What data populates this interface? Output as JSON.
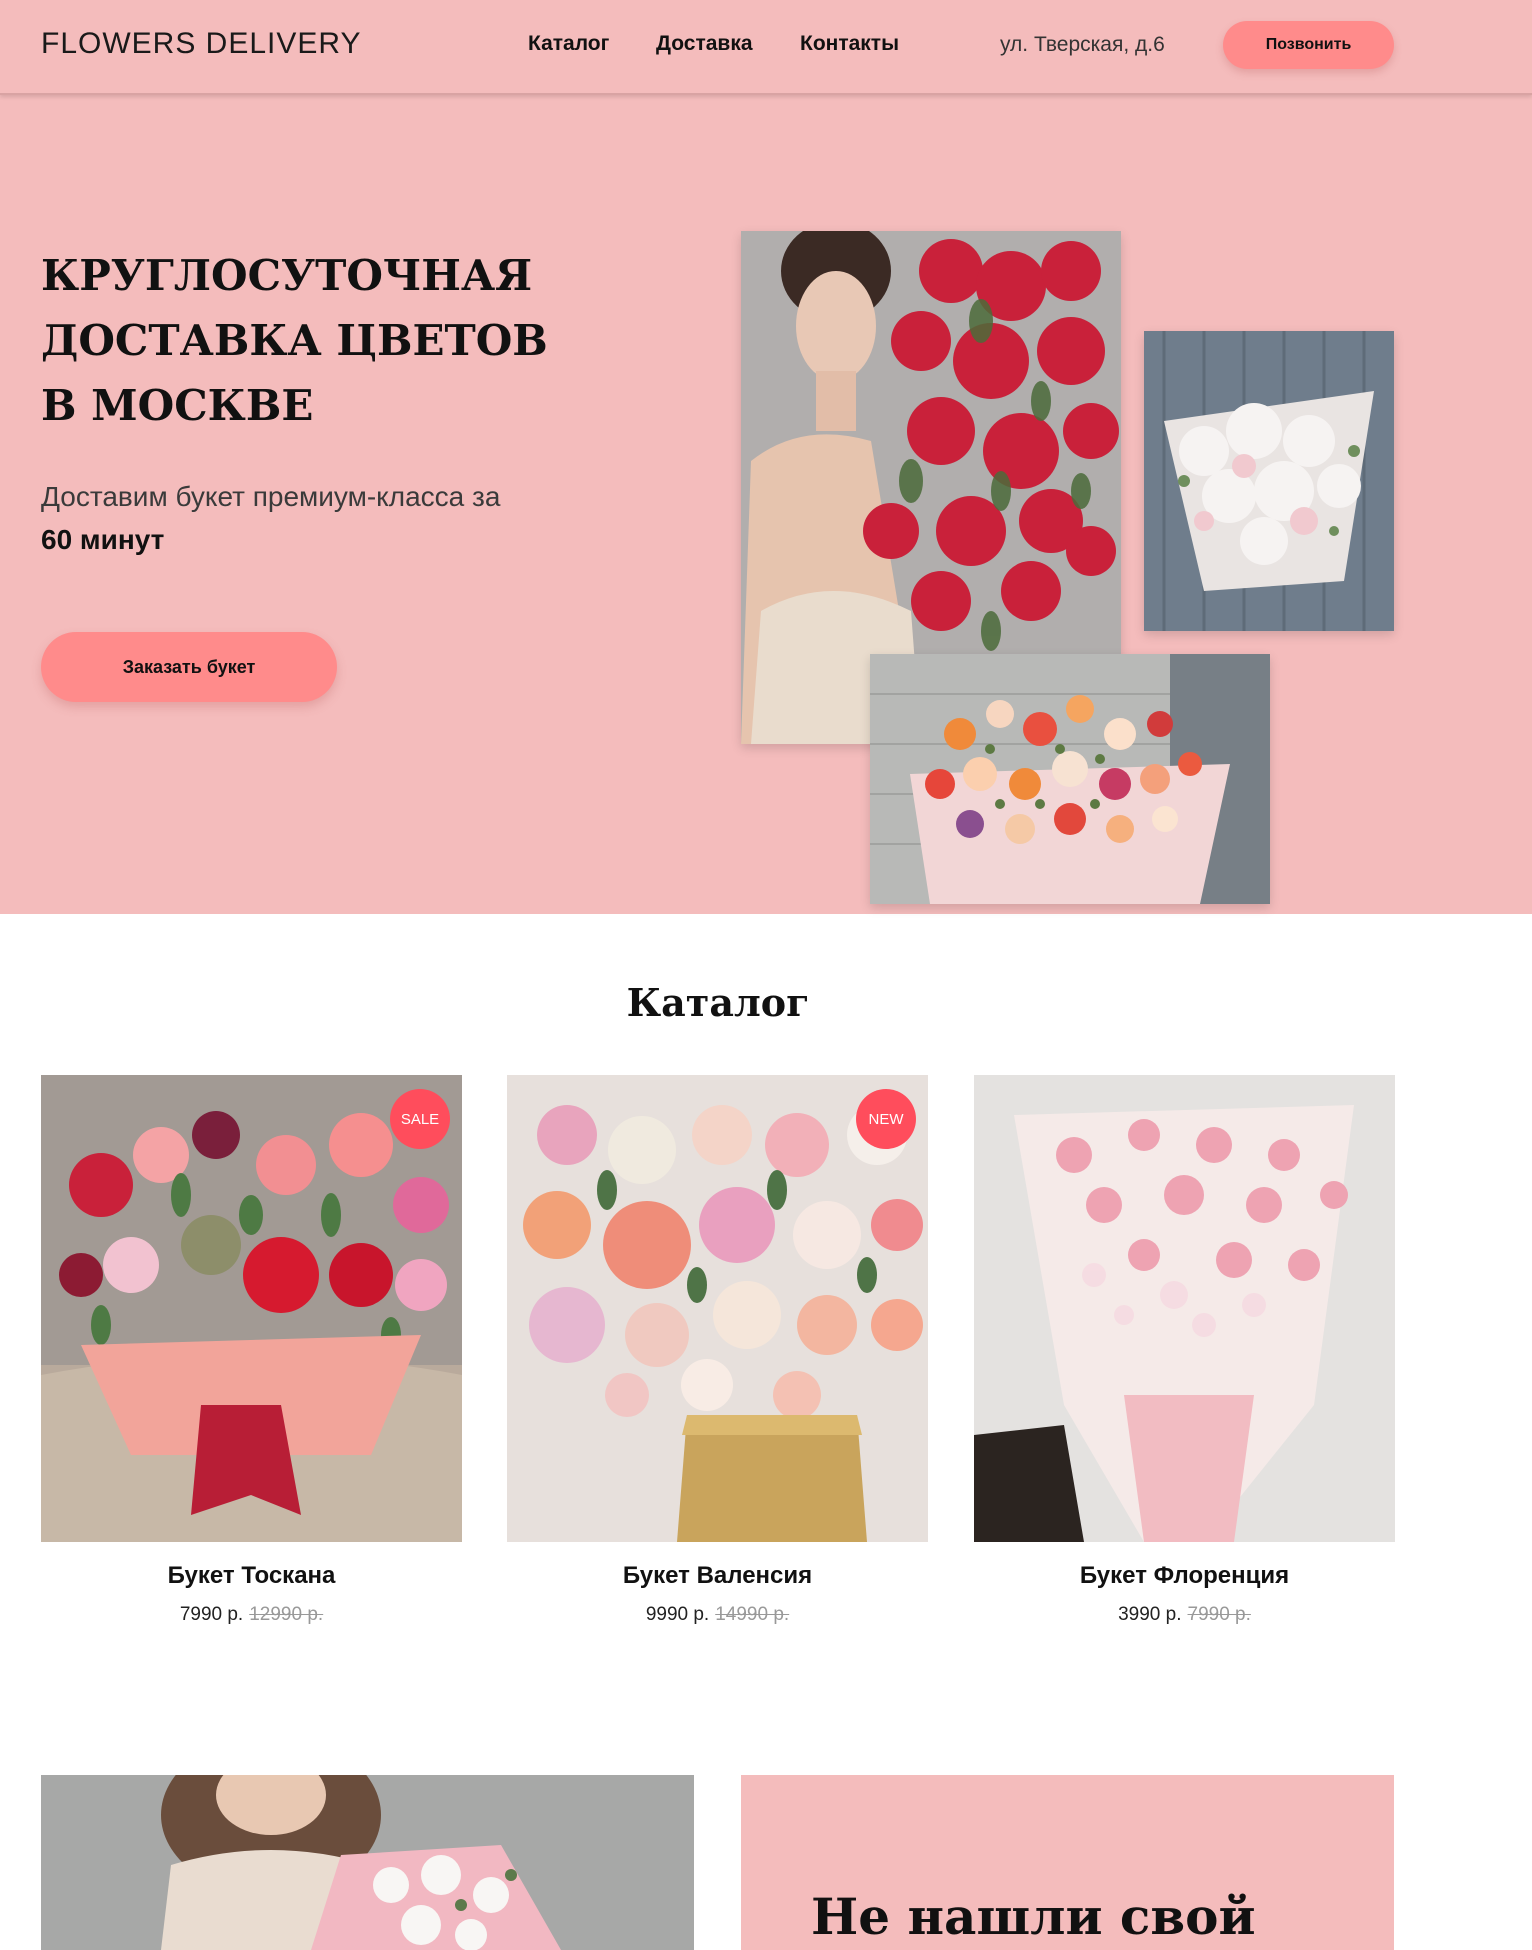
{
  "header": {
    "logo": "FLOWERS DELIVERY",
    "nav": [
      "Каталог",
      "Доставка",
      "Контакты"
    ],
    "address": "ул. Тверская, д.6",
    "call_button": "Позвонить"
  },
  "hero": {
    "title": "Круглосуточная доставка цветов в Москве",
    "subtitle": "Доставим букет премиум-класса за",
    "subtitle_bold": "60 минут",
    "order_button": "Заказать букет"
  },
  "catalog": {
    "title": "Каталог",
    "items": [
      {
        "name": "Букет Тоскана",
        "price": "7990 р.",
        "old_price": "12990 р.",
        "badge": "SALE"
      },
      {
        "name": "Букет Валенсия",
        "price": "9990 р.",
        "old_price": "14990 р.",
        "badge": "NEW"
      },
      {
        "name": "Букет Флоренция",
        "price": "3990 р.",
        "old_price": "7990 р.",
        "badge": ""
      }
    ]
  },
  "promo": {
    "title": "Не нашли свой"
  },
  "colors": {
    "header_bg": "#f4bcbc",
    "accent": "#ff8b8b",
    "badge": "#ff4d5c"
  }
}
